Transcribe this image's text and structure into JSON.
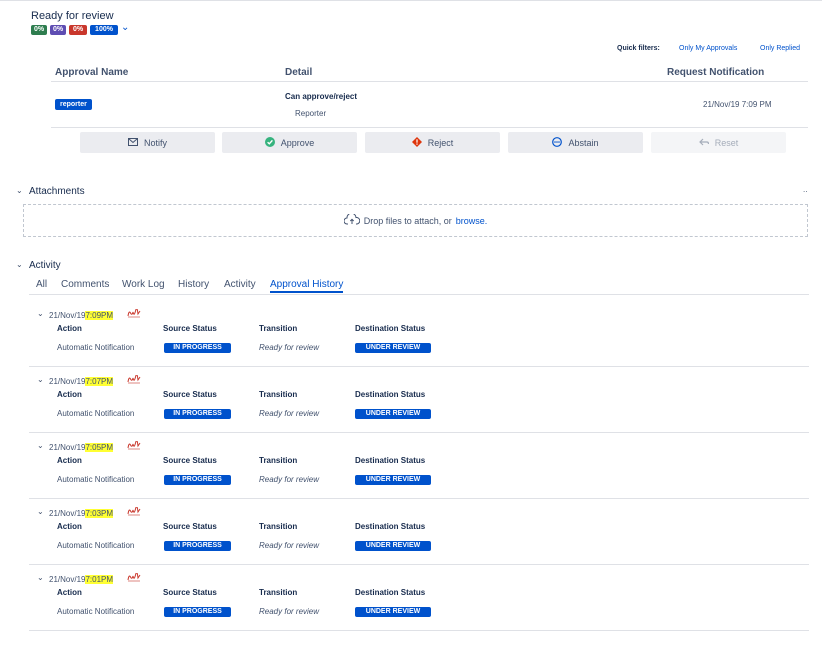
{
  "status": {
    "title": "Ready for review",
    "progress": [
      {
        "label": "0%",
        "color": "#2e7d4f"
      },
      {
        "label": "0%",
        "color": "#5e4db2"
      },
      {
        "label": "0%",
        "color": "#c9372c"
      },
      {
        "label": "100%",
        "color": "#0052cc"
      }
    ]
  },
  "quick_filters": {
    "label": "Quick filters:",
    "only_my_approvals": "Only My Approvals",
    "only_replied": "Only Replied"
  },
  "approvals_table": {
    "headers": {
      "name": "Approval Name",
      "detail": "Detail",
      "request": "Request Notification"
    },
    "row": {
      "badge": "reporter",
      "detail_title": "Can approve/reject",
      "detail_sub": "Reporter",
      "time": "21/Nov/19 7:09 PM"
    }
  },
  "actions": {
    "notify": "Notify",
    "approve": "Approve",
    "reject": "Reject",
    "abstain": "Abstain",
    "reset": "Reset"
  },
  "attachments": {
    "title": "Attachments",
    "drop_text": "Drop files to attach, or",
    "browse": "browse."
  },
  "activity": {
    "title": "Activity",
    "tabs": [
      "All",
      "Comments",
      "Work Log",
      "History",
      "Activity",
      "Approval History"
    ],
    "active_tab": "Approval History",
    "columns": {
      "action": "Action",
      "source": "Source Status",
      "transition": "Transition",
      "destination": "Destination Status"
    },
    "entries": [
      {
        "date": "21/Nov/19",
        "time": "7:09",
        "ampm": "PM",
        "action": "Automatic Notification",
        "source": "IN PROGRESS",
        "transition": "Ready for review",
        "destination": "UNDER REVIEW"
      },
      {
        "date": "21/Nov/19",
        "time": "7:07",
        "ampm": "PM",
        "action": "Automatic Notification",
        "source": "IN PROGRESS",
        "transition": "Ready for review",
        "destination": "UNDER REVIEW"
      },
      {
        "date": "21/Nov/19",
        "time": "7:05",
        "ampm": "PM",
        "action": "Automatic Notification",
        "source": "IN PROGRESS",
        "transition": "Ready for review",
        "destination": "UNDER REVIEW"
      },
      {
        "date": "21/Nov/19",
        "time": "7:03",
        "ampm": "PM",
        "action": "Automatic Notification",
        "source": "IN PROGRESS",
        "transition": "Ready for review",
        "destination": "UNDER REVIEW"
      },
      {
        "date": "21/Nov/19",
        "time": "7:01",
        "ampm": "PM",
        "action": "Automatic Notification",
        "source": "IN PROGRESS",
        "transition": "Ready for review",
        "destination": "UNDER REVIEW"
      }
    ]
  },
  "icons": {
    "notify": "envelope-icon",
    "approve": "check-circle-icon",
    "reject": "reject-diamond-icon",
    "abstain": "abstain-circle-icon",
    "reset": "undo-icon",
    "upload": "cloud-upload-icon",
    "entry": "signature-icon"
  }
}
